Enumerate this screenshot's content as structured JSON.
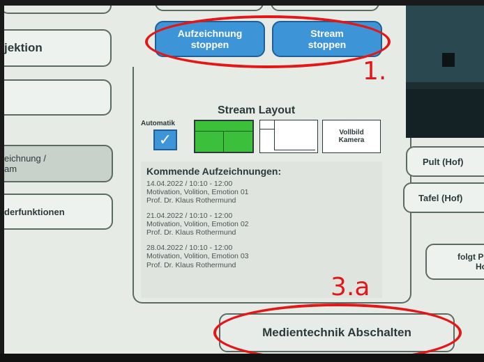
{
  "left_nav": {
    "projektion_label": "jektion",
    "aufzeichnung_label_line1": "eichnung /",
    "aufzeichnung_label_line2": "am",
    "sonder_label": "derfunktionen"
  },
  "controls": {
    "record_stop_label_line1": "Aufzeichnung",
    "record_stop_label_line2": "stoppen",
    "stream_stop_label_line1": "Stream",
    "stream_stop_label_line2": "stoppen"
  },
  "stream_layout": {
    "title": "Stream Layout",
    "automatik_label": "Automatik",
    "automatik_checked": true,
    "vollbild_label_line1": "Vollbild",
    "vollbild_label_line2": "Kamera"
  },
  "recordings": {
    "title": "Kommende Aufzeichnungen:",
    "items": [
      {
        "date": "14.04.2022 / 10:10 - 12:00",
        "course": "Motivation, Volition, Emotion 01",
        "lecturer": "Prof. Dr. Klaus Rothermund"
      },
      {
        "date": "21.04.2022 / 10:10 - 12:00",
        "course": "Motivation, Volition, Emotion 02",
        "lecturer": "Prof. Dr. Klaus Rothermund"
      },
      {
        "date": "28.04.2022 / 10:10 - 12:00",
        "course": "Motivation, Volition, Emotion 03",
        "lecturer": "Prof. Dr. Klaus Rothermund"
      }
    ]
  },
  "camera_presets": {
    "pult": "Pult (Hof)",
    "tafel": "Tafel (Hof)",
    "folgt_line1": "folgt Pr",
    "folgt_line2": "Ho"
  },
  "footer": {
    "shutdown_label": "Medientechnik Abschalten"
  },
  "annotations": {
    "step1": "1.",
    "step3a": "3.a",
    "color": "#e21818"
  },
  "colors": {
    "accent_blue": "#3d95d8",
    "layout_green": "#3cc03c",
    "background": "#e6ebe6"
  }
}
